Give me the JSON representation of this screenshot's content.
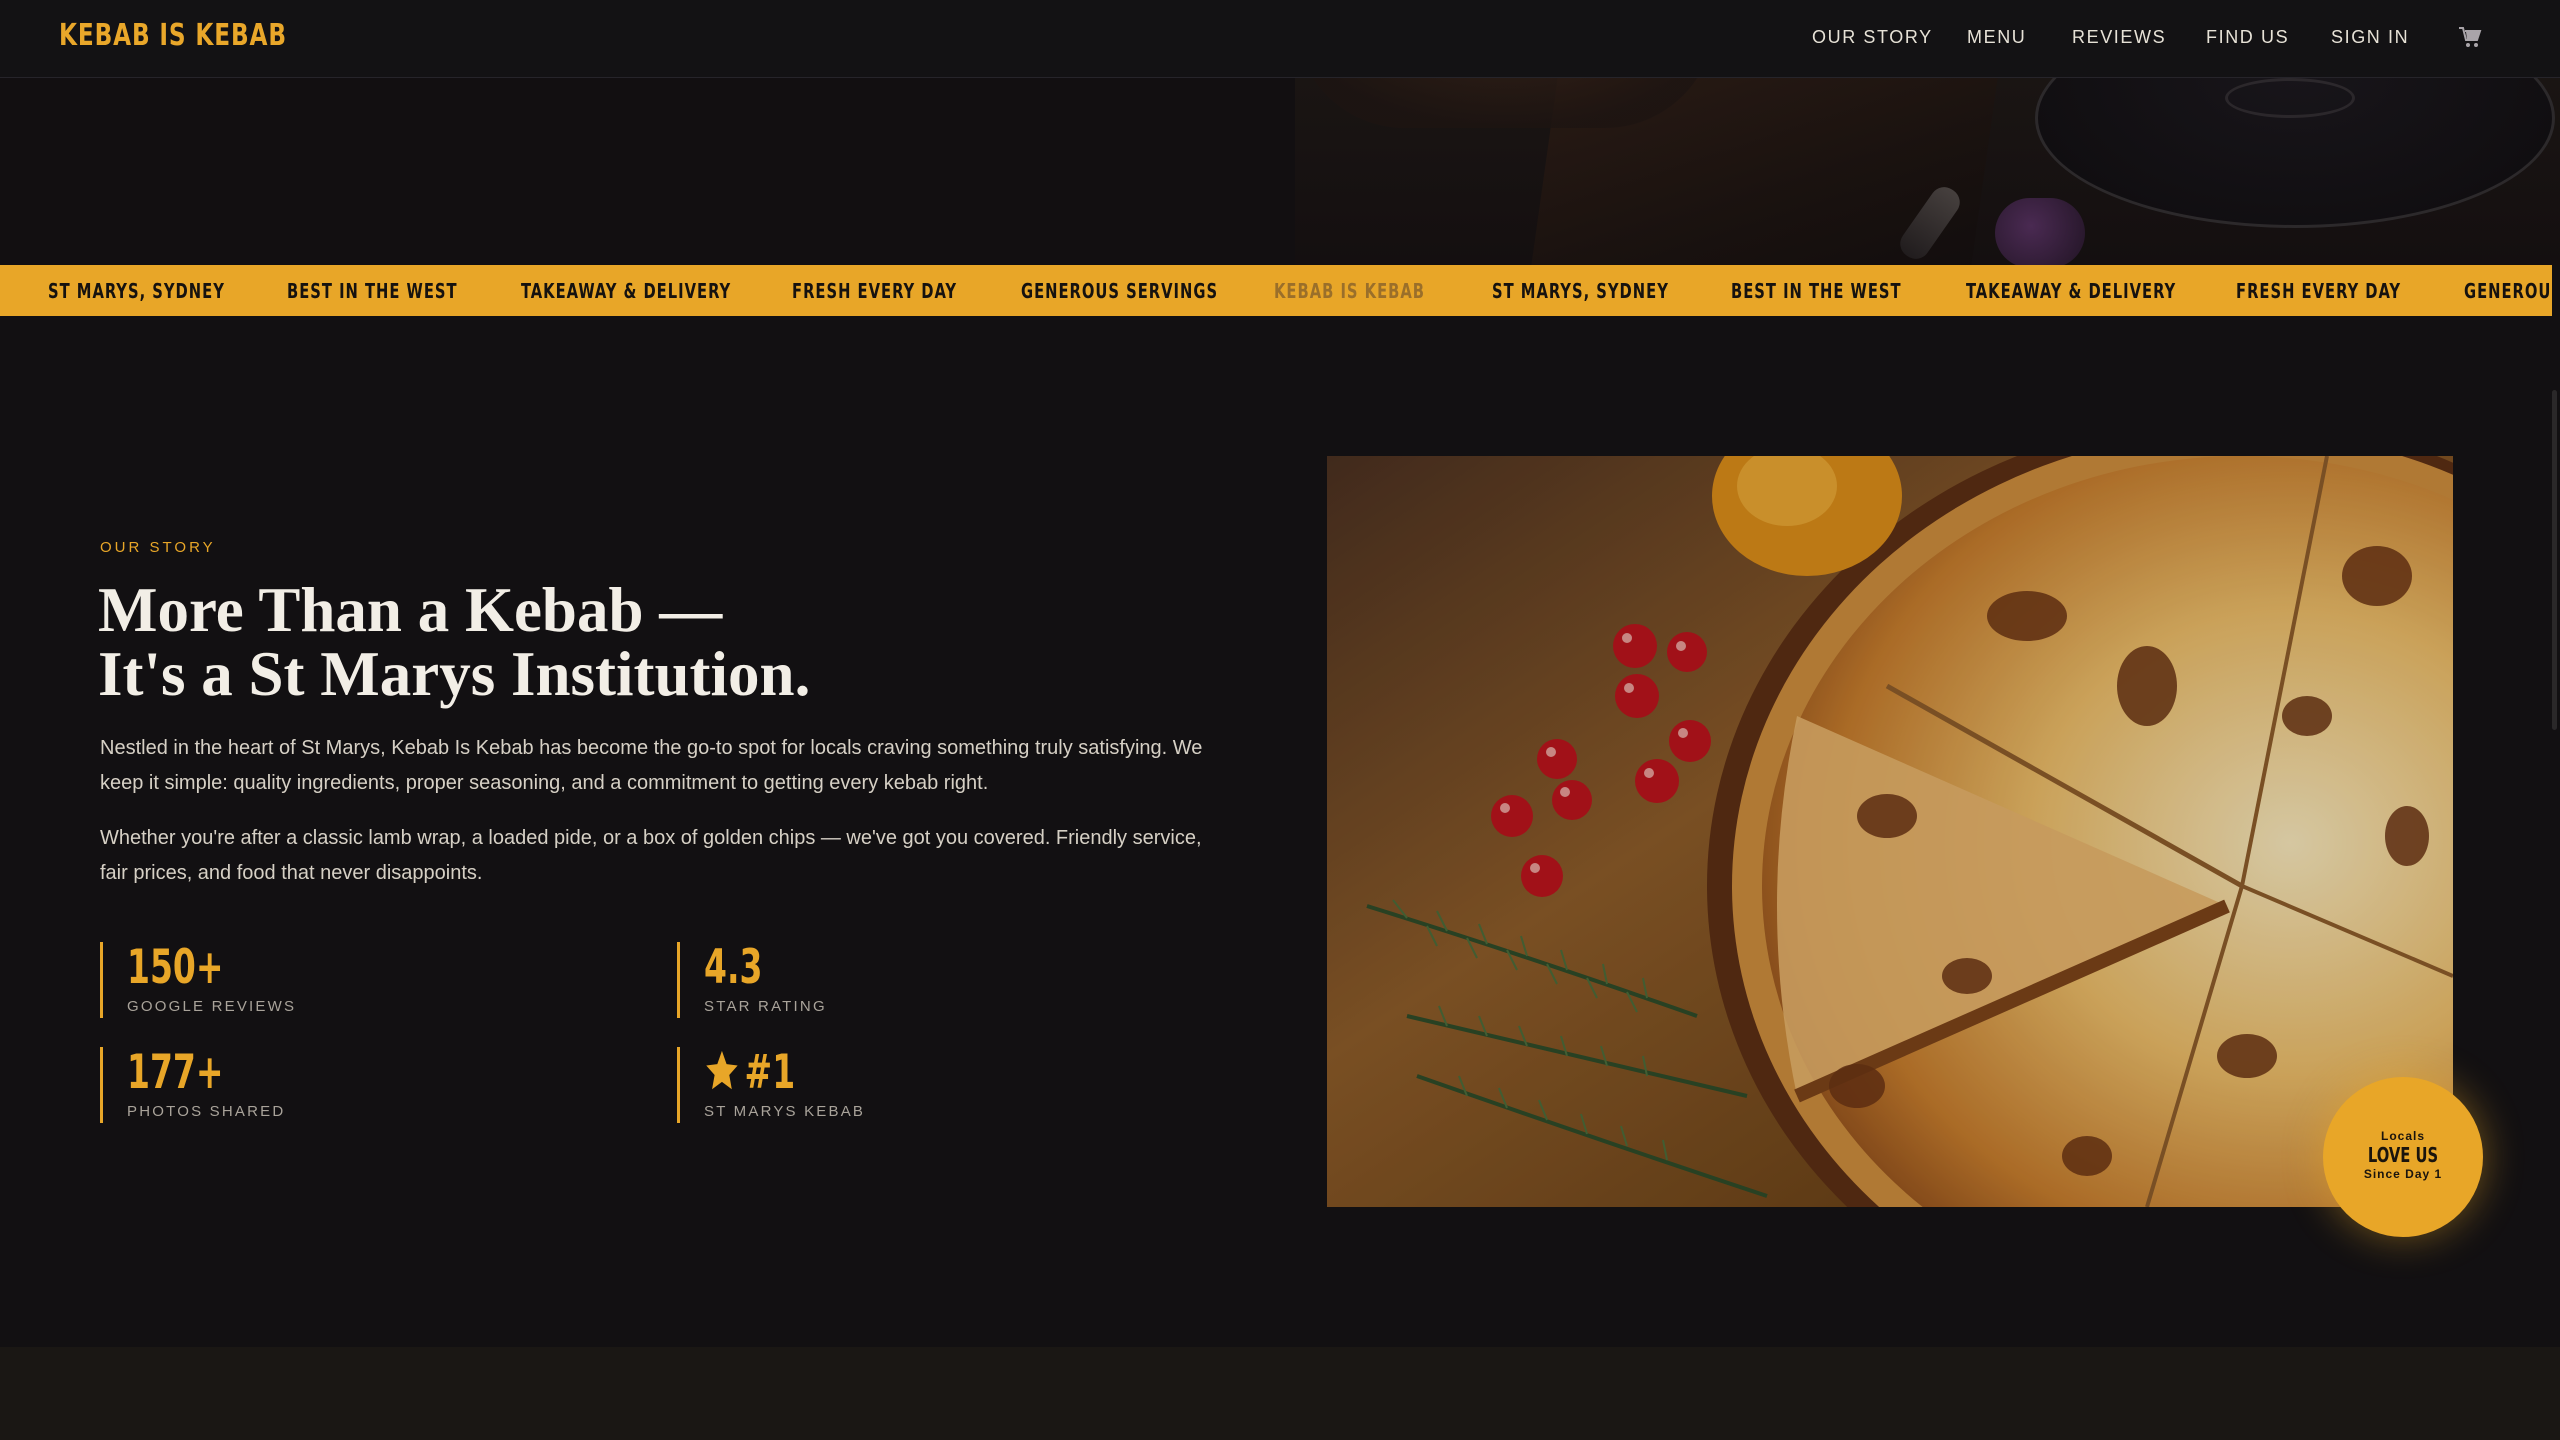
{
  "nav": {
    "brand": "KEBAB IS KEBAB",
    "links": [
      "OUR STORY",
      "MENU",
      "REVIEWS",
      "FIND US",
      "SIGN IN"
    ],
    "cart_icon": "cart-icon"
  },
  "ticker": {
    "items": [
      "ST MARYS, SYDNEY",
      "BEST IN THE WEST",
      "TAKEAWAY & DELIVERY",
      "FRESH EVERY DAY",
      "GENEROUS SERVINGS",
      "KEBAB IS KEBAB",
      "ST MARYS, SYDNEY",
      "BEST IN THE WEST",
      "TAKEAWAY & DELIVERY",
      "FRESH EVERY DAY",
      "GENEROUS"
    ]
  },
  "story": {
    "eyebrow": "OUR STORY",
    "headline_line1": "More Than a Kebab —",
    "headline_line2": "It's a St Marys Institution.",
    "para1": "Nestled in the heart of St Marys, Kebab Is Kebab has become the go-to spot for locals craving something truly satisfying. We keep it simple: quality ingredients, proper seasoning, and a commitment to getting every kebab right.",
    "para2": "Whether you're after a classic lamb wrap, a loaded pide, or a box of golden chips — we've got you covered. Friendly service, fair prices, and food that never disappoints.",
    "stats": [
      {
        "value": "150+",
        "label": "GOOGLE REVIEWS"
      },
      {
        "value": "4.3",
        "label": "STAR RATING"
      },
      {
        "value": "177+",
        "label": "PHOTOS SHARED"
      },
      {
        "value": "#1",
        "label": "ST MARYS KEBAB",
        "icon": "star-icon"
      }
    ]
  },
  "badge": {
    "top": "Locals",
    "main": "LOVE US",
    "bottom": "Since Day 1"
  },
  "colors": {
    "accent": "#e8a628",
    "background": "#121012",
    "text": "#f2eee6"
  }
}
